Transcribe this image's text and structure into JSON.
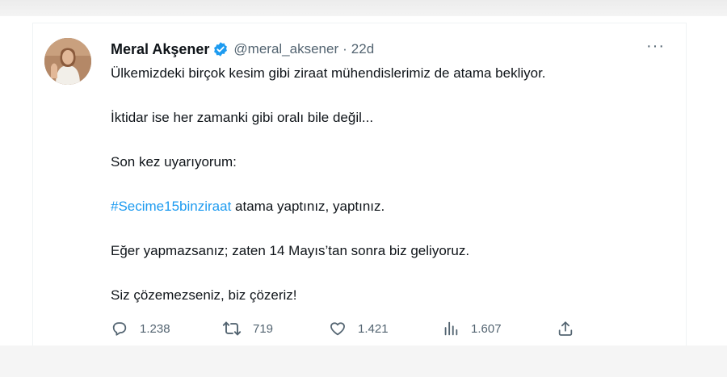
{
  "tweet": {
    "author_name": "Meral Akşener",
    "handle": "@meral_aksener",
    "separator": "·",
    "time": "22d",
    "more_label": "···",
    "paragraphs": {
      "p1": "Ülkemizdeki birçok kesim gibi ziraat mühendislerimiz de atama bekliyor.",
      "p2": "İktidar ise her zamanki gibi oralı bile değil...",
      "p3": "Son kez uyarıyorum:",
      "p4_hashtag": "#Secime15binziraat",
      "p4_rest": " atama yaptınız, yaptınız.",
      "p5": "Eğer yapmazsanız; zaten 14 Mayıs’tan sonra biz geliyoruz.",
      "p6": "Siz çözemezseniz, biz çözeriz!"
    },
    "actions": {
      "replies": "1.238",
      "retweets": "719",
      "likes": "1.421",
      "views": "1.607"
    },
    "icons": {
      "verified": "verified-badge-icon",
      "reply": "reply-icon",
      "retweet": "retweet-icon",
      "like": "heart-icon",
      "views": "views-icon",
      "share": "share-icon"
    },
    "colors": {
      "text": "#0f1419",
      "secondary": "#536471",
      "link": "#1d9bf0",
      "verified": "#1d9bf0"
    }
  }
}
